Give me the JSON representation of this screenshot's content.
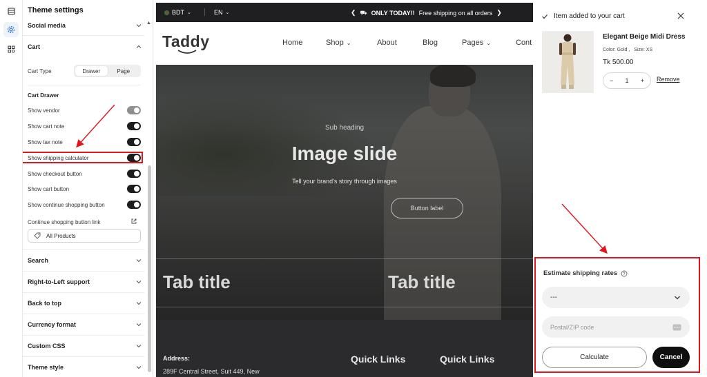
{
  "settings": {
    "title": "Theme settings",
    "social_media": "Social media",
    "cart": "Cart",
    "cart_type_label": "Cart Type",
    "cart_type_options": [
      "Drawer",
      "Page"
    ],
    "cart_type_selected": "Drawer",
    "cart_drawer_label": "Cart Drawer",
    "toggles": [
      {
        "label": "Show vendor",
        "on": false
      },
      {
        "label": "Show cart note",
        "on": true
      },
      {
        "label": "Show tax note",
        "on": true
      },
      {
        "label": "Show shipping calculator",
        "on": true
      },
      {
        "label": "Show checkout button",
        "on": true
      },
      {
        "label": "Show cart button",
        "on": true
      },
      {
        "label": "Show continue shopping button",
        "on": true
      }
    ],
    "continue_link_label": "Continue shopping button link",
    "continue_link_value": "All Products",
    "sections": [
      "Search",
      "Right-to-Left support",
      "Back to top",
      "Currency format",
      "Custom CSS",
      "Theme style"
    ]
  },
  "store": {
    "currency": "BDT",
    "language": "EN",
    "announcement_bold": "ONLY TODAY!!",
    "announcement_text": "Free shipping on all orders",
    "logo": "Taddy",
    "nav": [
      "Home",
      "Shop",
      "About",
      "Blog",
      "Pages",
      "Cont"
    ],
    "hero_sub": "Sub heading",
    "hero_title": "Image slide",
    "hero_text": "Tell your brand's story through images",
    "hero_button": "Button label",
    "tab_title_1": "Tab title",
    "tab_title_2": "Tab title",
    "footer_address_label": "Address:",
    "footer_address": "289F Central Street, Suit 449, New",
    "footer_quick_links_1": "Quick Links",
    "footer_quick_links_2": "Quick Links"
  },
  "drawer": {
    "header": "Item added to your cart",
    "product_name": "Elegant Beige Midi Dress",
    "color_label": "Color: Gold ,",
    "size_label": "Size: XS",
    "price": "Tk 500.00",
    "quantity": "1",
    "remove": "Remove",
    "shipping_title": "Estimate shipping rates",
    "shipping_select": "---",
    "zip_placeholder": "Postal/ZIP code",
    "calculate": "Calculate",
    "cancel": "Cancel"
  },
  "colors": {
    "annotation_red": "#e0161c",
    "accent_blue": "#2f6fd6",
    "toggle_on": "#1d1d1d"
  }
}
